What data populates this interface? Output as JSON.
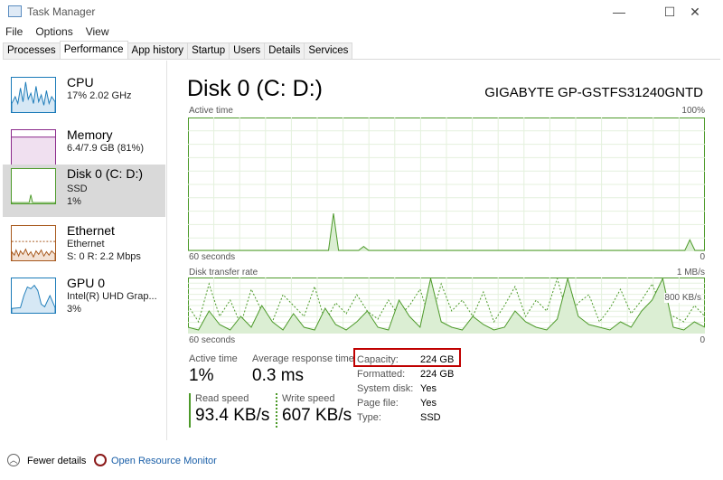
{
  "window": {
    "title": "Task Manager",
    "minimize": "—",
    "maximize": "☐",
    "close": "✕"
  },
  "menu": [
    "File",
    "Options",
    "View"
  ],
  "tabs": [
    "Processes",
    "Performance",
    "App history",
    "Startup",
    "Users",
    "Details",
    "Services"
  ],
  "active_tab": "Performance",
  "sidebar": [
    {
      "name": "CPU",
      "line1": "17% 2.02 GHz",
      "line2": "",
      "color": "#1a7ab8"
    },
    {
      "name": "Memory",
      "line1": "6.4/7.9 GB (81%)",
      "line2": "",
      "color": "#8b2a8b"
    },
    {
      "name": "Disk 0 (C: D:)",
      "line1": "SSD",
      "line2": "1%",
      "color": "#4d9a2a"
    },
    {
      "name": "Ethernet",
      "line1": "Ethernet",
      "line2": "S: 0 R: 2.2 Mbps",
      "color": "#a7581c"
    },
    {
      "name": "GPU 0",
      "line1": "Intel(R) UHD Grap...",
      "line2": "3%",
      "color": "#1a7ab8"
    }
  ],
  "main": {
    "title": "Disk 0 (C: D:)",
    "model": "GIGABYTE GP-GSTFS31240GNTD",
    "graph1": {
      "label": "Active time",
      "max": "100%",
      "time": "60 seconds",
      "min": "0",
      "samples": [
        0,
        0,
        0,
        0,
        0,
        0,
        0,
        0,
        0,
        0,
        0,
        0,
        0,
        0,
        0,
        0,
        0,
        0,
        0,
        0,
        0,
        0,
        0,
        0,
        0,
        0,
        0,
        0,
        0,
        28,
        0,
        0,
        0,
        0,
        0,
        3,
        0,
        0,
        0,
        0,
        0,
        0,
        0,
        0,
        0,
        0,
        0,
        0,
        0,
        0,
        0,
        0,
        0,
        0,
        0,
        0,
        0,
        0,
        0,
        0,
        0,
        0,
        0,
        0,
        0,
        0,
        0,
        0,
        0,
        0,
        0,
        0,
        0,
        0,
        0,
        0,
        0,
        0,
        0,
        0,
        0,
        0,
        0,
        0,
        0,
        0,
        0,
        0,
        0,
        0,
        0,
        0,
        0,
        0,
        0,
        0,
        0,
        0,
        0,
        0,
        8,
        0,
        0,
        0
      ]
    },
    "graph2": {
      "label": "Disk transfer rate",
      "max": "1 MB/s",
      "mid": "800 KB/s",
      "time": "60 seconds",
      "min": "0",
      "read": [
        10,
        5,
        40,
        15,
        5,
        30,
        10,
        50,
        20,
        5,
        35,
        10,
        5,
        45,
        15,
        5,
        20,
        40,
        10,
        5,
        60,
        30,
        10,
        100,
        20,
        10,
        5,
        30,
        15,
        5,
        10,
        40,
        20,
        10,
        5,
        25,
        100,
        30,
        15,
        10,
        5,
        20,
        10,
        40,
        60,
        100,
        10,
        5,
        20,
        10
      ],
      "write": [
        50,
        20,
        90,
        30,
        60,
        15,
        80,
        40,
        20,
        70,
        50,
        30,
        85,
        20,
        55,
        35,
        70,
        40,
        25,
        60,
        30,
        50,
        80,
        20,
        90,
        40,
        60,
        30,
        75,
        20,
        50,
        85,
        30,
        60,
        40,
        100,
        30,
        55,
        70,
        20,
        45,
        80,
        35,
        60,
        90,
        40,
        30,
        20,
        50,
        30
      ]
    },
    "stats": {
      "active_time_label": "Active time",
      "active_time": "1%",
      "resp_label": "Average response time",
      "resp": "0.3 ms",
      "read_label": "Read speed",
      "read": "93.4 KB/s",
      "write_label": "Write speed",
      "write": "607 KB/s"
    },
    "props": [
      [
        "Capacity:",
        "224 GB"
      ],
      [
        "Formatted:",
        "224 GB"
      ],
      [
        "System disk:",
        "Yes"
      ],
      [
        "Page file:",
        "Yes"
      ],
      [
        "Type:",
        "SSD"
      ]
    ],
    "highlight_color": "#c00000"
  },
  "footer": {
    "fewer": "Fewer details",
    "monitor": "Open Resource Monitor"
  }
}
